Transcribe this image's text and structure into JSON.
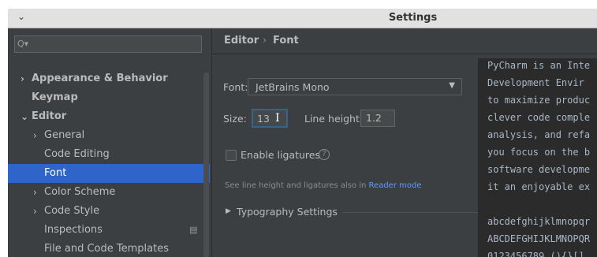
{
  "window": {
    "title": "Settings",
    "menu_glyph": "⌄"
  },
  "sidebar": {
    "search_placeholder": "",
    "search_icon": "Q▾",
    "items": [
      {
        "arrow": "›",
        "label": "Appearance & Behavior",
        "bold": true
      },
      {
        "arrow": "",
        "label": "Keymap",
        "bold": true
      },
      {
        "arrow": "⌄",
        "label": "Editor",
        "bold": true
      },
      {
        "arrow": "›",
        "label": "General",
        "bold": false
      },
      {
        "arrow": "",
        "label": "Code Editing",
        "bold": false
      },
      {
        "arrow": "",
        "label": "Font",
        "bold": false,
        "selected": true
      },
      {
        "arrow": "›",
        "label": "Color Scheme",
        "bold": false
      },
      {
        "arrow": "›",
        "label": "Code Style",
        "bold": false
      },
      {
        "arrow": "",
        "label": "Inspections",
        "bold": false
      },
      {
        "arrow": "",
        "label": "File and Code Templates",
        "bold": false
      }
    ]
  },
  "breadcrumb": {
    "parent": "Editor",
    "separator": "›",
    "current": "Font"
  },
  "font_settings": {
    "font_label": "Font:",
    "font_value": "JetBrains Mono",
    "size_label": "Size:",
    "size_value": "13",
    "line_height_label": "Line height:",
    "line_height_value": "1.2",
    "ligatures_label": "Enable ligatures",
    "ligatures_checked": false,
    "hint_text": "See line height and ligatures also in ",
    "hint_link": "Reader mode",
    "typography_label": "Typography Settings"
  },
  "preview": {
    "lines": [
      "PyCharm is an Inte",
      "Development Envir",
      "to maximize produc",
      "clever code comple",
      "analysis, and refa",
      "you focus on the b",
      "software developme",
      "it an enjoyable ex",
      "",
      "abcdefghijklmnopqr",
      "ABCDEFGHIJKLMNOPQR",
      "0123456789 (){}[]"
    ]
  },
  "colors": {
    "selection": "#2f65ca",
    "link": "#589df6",
    "background": "#3c3f41",
    "preview_bg": "#2b2b2b"
  }
}
